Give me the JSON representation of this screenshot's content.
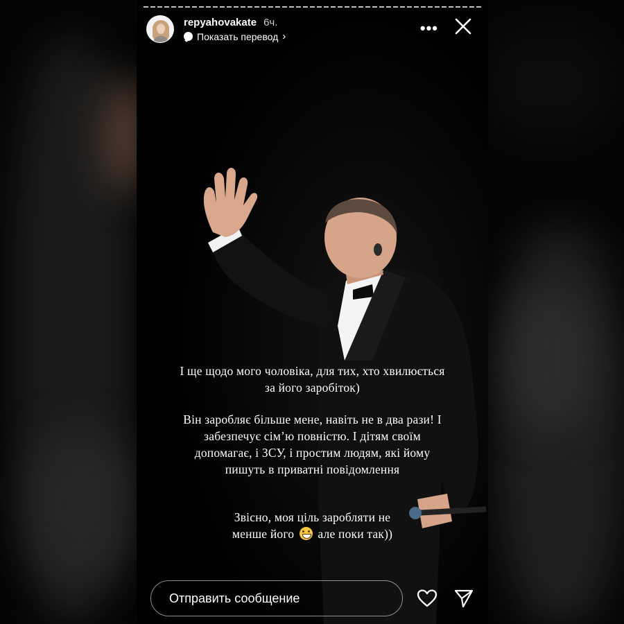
{
  "story": {
    "username": "repyahovakate",
    "time": "6ч.",
    "translate_label": "Показать перевод",
    "translate_chevron": "›",
    "more_label": "•••",
    "caption": {
      "p1_line1": "І ще щодо мого чоловіка, для тих, хто хвилюється",
      "p1_line2": "за його заробіток)",
      "p2_line1": "Він заробляє більше мене, навіть не в два рази! І",
      "p2_line2": "забезпечує сім’ю повністю. І дітям своїм",
      "p2_line3": "допомагає, і ЗСУ, і простим людям, які йому",
      "p2_line4": "пишуть в приватні повідомлення",
      "p3_line1": "Звісно, моя ціль заробляти не",
      "p3_line2a": "менше його",
      "p3_line2b": "але поки так))"
    },
    "emoji": "grinning-face",
    "progress_fraction": 0.0
  },
  "footer": {
    "message_placeholder": "Отправить сообщение"
  },
  "icons": {
    "avatar": "profile-avatar",
    "translate": "chat-bubble-icon",
    "more": "more-dots-icon",
    "close": "close-icon",
    "heart": "heart-icon",
    "send": "send-icon"
  },
  "colors": {
    "background": "#000000",
    "text": "#ffffff",
    "emoji": "#f7c63c"
  }
}
